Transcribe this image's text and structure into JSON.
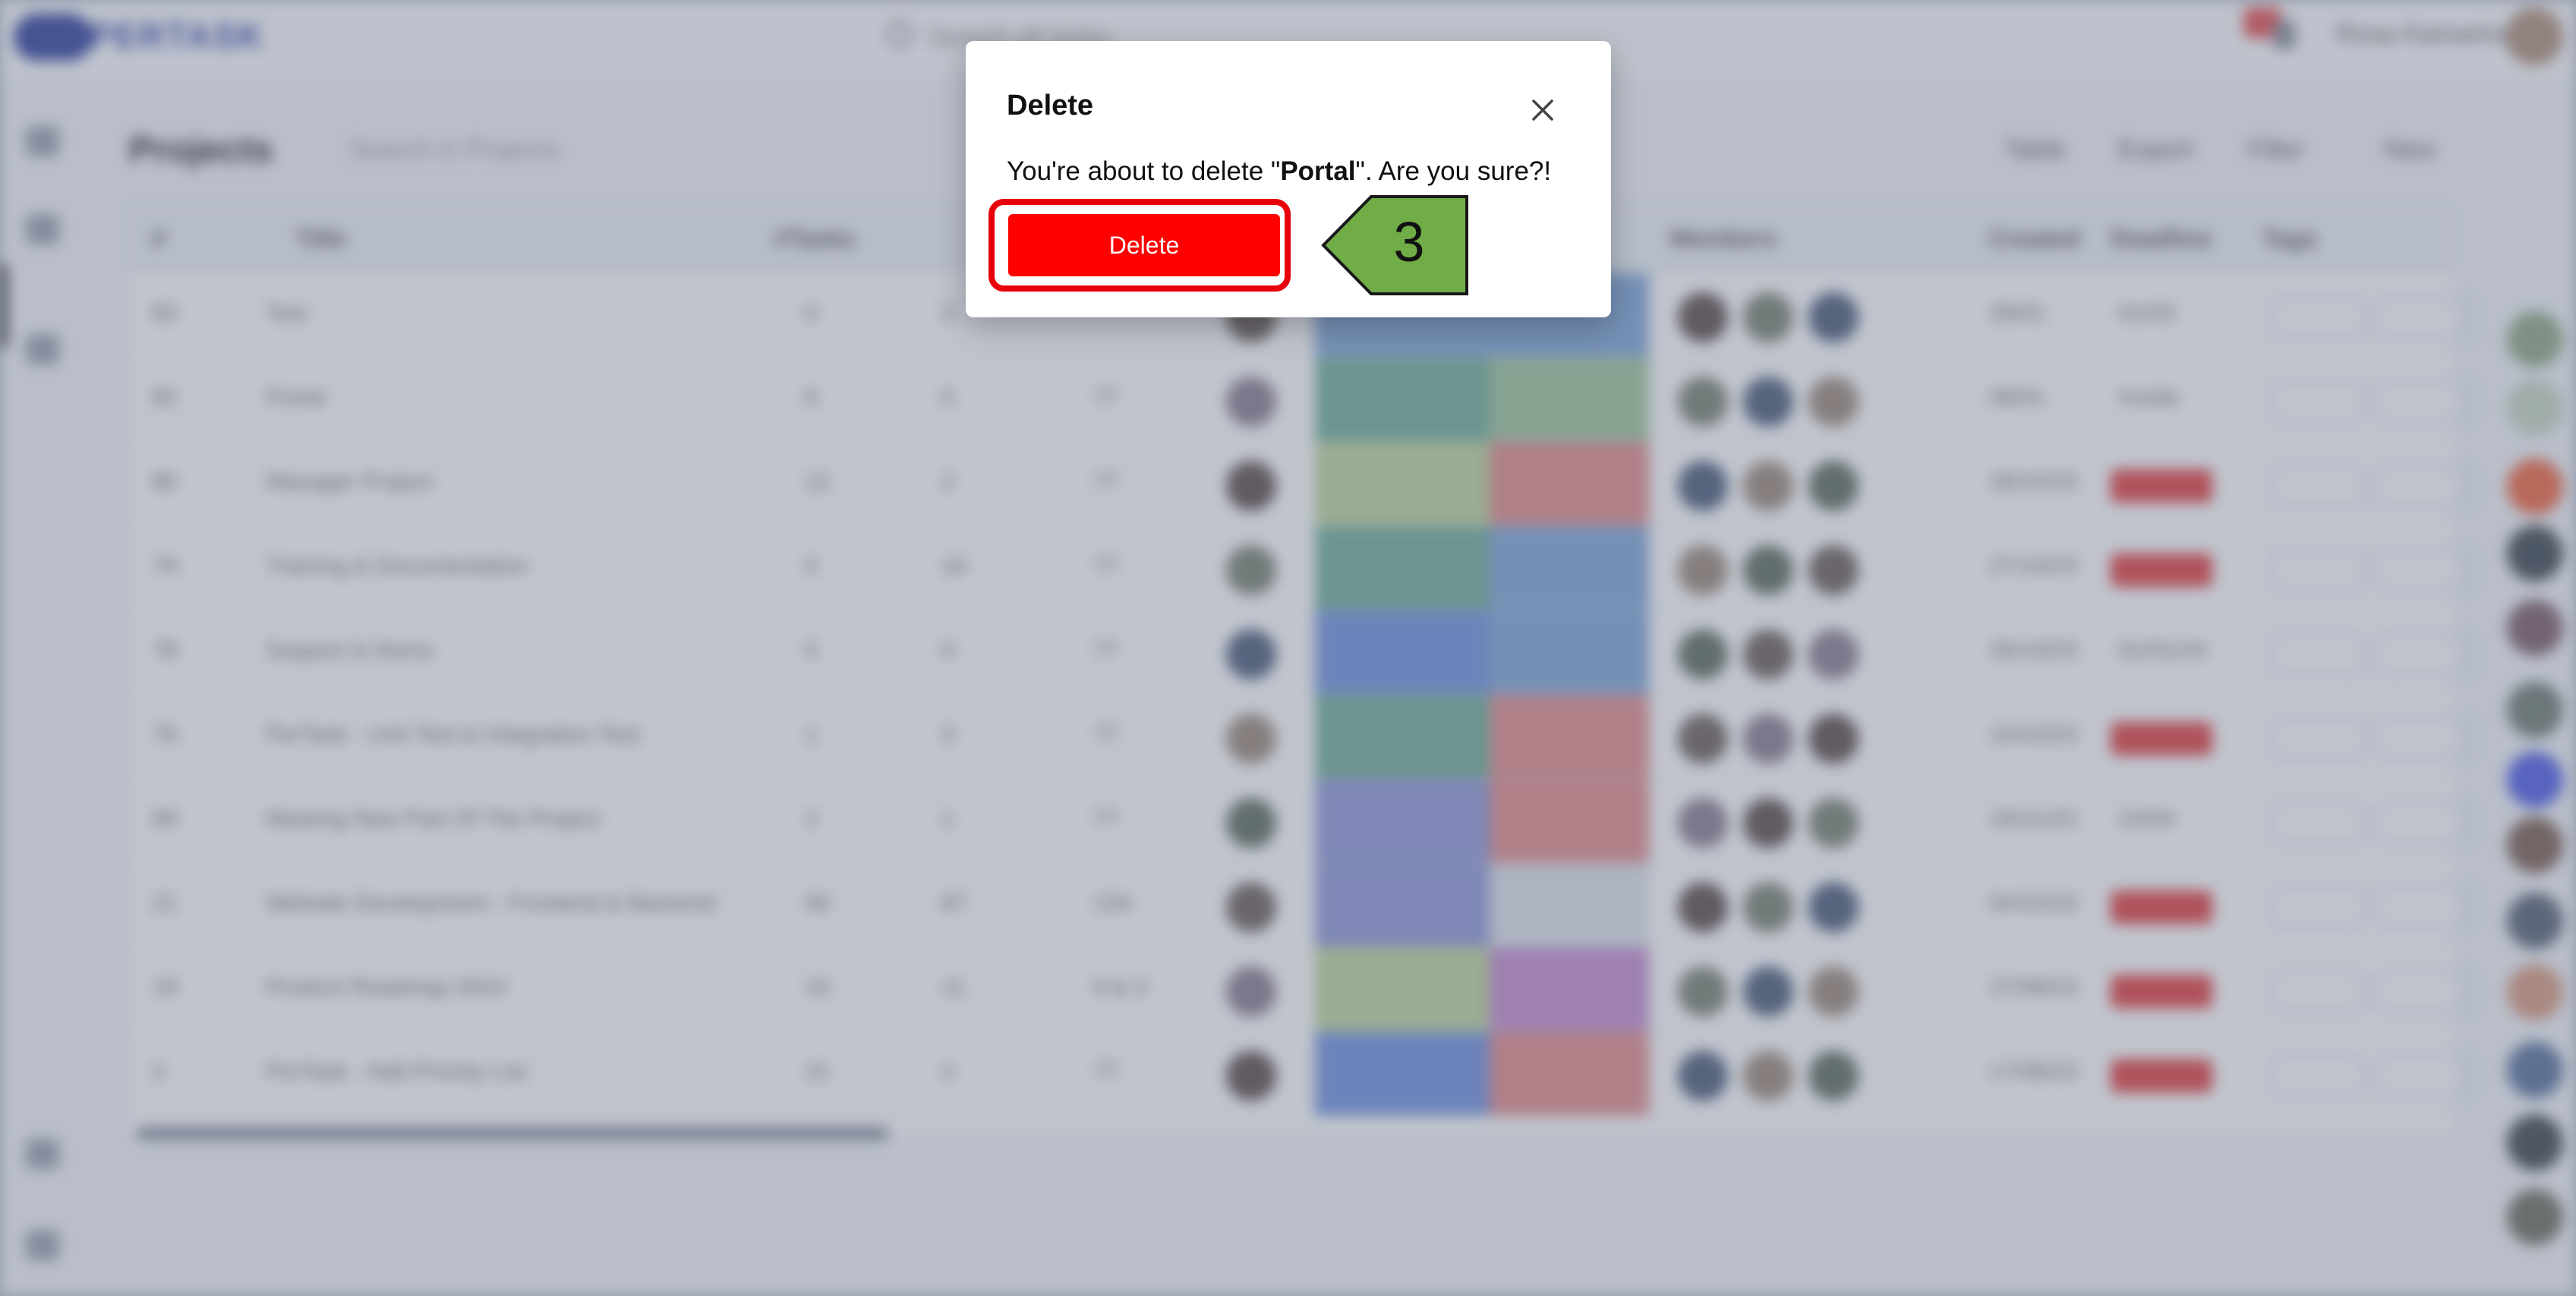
{
  "app": {
    "logo_text": "PERTASK",
    "search_placeholder": "Search all tasks",
    "user_name": "Rosa Kamarina",
    "page_title": "Projects",
    "project_search_placeholder": "Search in Projects",
    "toolbar": [
      "Table",
      "Export",
      "Filter",
      "New"
    ],
    "columns": [
      "#",
      "Title",
      "#Tasks",
      "Members",
      "Created",
      "Deadline",
      "Tags"
    ],
    "rows": [
      {
        "id": "83",
        "title": "Test",
        "tasks": "0",
        "members": "3",
        "col3": "",
        "status_color": "#7fa6d8",
        "priority_color": "#7fa6d8",
        "created": "28/01",
        "deadline": "01/03"
      },
      {
        "id": "82",
        "title": "Portal",
        "tasks": "6",
        "members": "5",
        "col3": "77",
        "status_color": "#6fae98",
        "priority_color": "#9ec79a",
        "created": "08/01",
        "deadline": "Inside"
      },
      {
        "id": "80",
        "title": "Manager Project",
        "tasks": "12",
        "members": "2",
        "col3": "77",
        "status_color": "#bfd79a",
        "priority_color": "#e48a8a",
        "created": "28/10/23",
        "deadline": ""
      },
      {
        "id": "79",
        "title": "Training & Documentation",
        "tasks": "5",
        "members": "16",
        "col3": "77",
        "status_color": "#6fae98",
        "priority_color": "#7fa6d8",
        "created": "27/10/23",
        "deadline": ""
      },
      {
        "id": "78",
        "title": "Support & Demo",
        "tasks": "5",
        "members": "0",
        "col3": "77",
        "status_color": "#6f92e0",
        "priority_color": "#7fa6d8",
        "created": "26/10/23",
        "deadline": "01/01/24"
      },
      {
        "id": "76",
        "title": "PerTask - Unit Test & Integration Test",
        "tasks": "1",
        "members": "3",
        "col3": "77",
        "status_color": "#6fae98",
        "priority_color": "#e48a8a",
        "created": "10/10/23",
        "deadline": ""
      },
      {
        "id": "69",
        "title": "Meeting New Part Of The Project",
        "tasks": "2",
        "members": "1",
        "col3": "77",
        "status_color": "#8f98d8",
        "priority_color": "#e48a8a",
        "created": "18/11/23",
        "deadline": "24/04"
      },
      {
        "id": "21",
        "title": "Website Development - Frontend & Backend",
        "tasks": "56",
        "members": "87",
        "col3": "134",
        "status_color": "#8f98d8",
        "priority_color": "#dfe3e9",
        "created": "04/10/23",
        "deadline": ""
      },
      {
        "id": "19",
        "title": "Product Roadmap 2024",
        "tasks": "10",
        "members": "11",
        "col3": "9 & 3",
        "status_color": "#bfd79a",
        "priority_color": "#c58bd0",
        "created": "27/08/23",
        "deadline": ""
      },
      {
        "id": "3",
        "title": "PerTask - Add Priority List",
        "tasks": "21",
        "members": "2",
        "col3": "77",
        "status_color": "#6f92e0",
        "priority_color": "#e48a8a",
        "created": "17/08/23",
        "deadline": ""
      }
    ]
  },
  "modal": {
    "title": "Delete",
    "message_prefix": "You're about to delete \"",
    "item_name": "Portal",
    "message_suffix": "\". Are you sure?!",
    "delete_label": "Delete",
    "close_icon": "close-icon"
  },
  "annotation": {
    "step_number": "3",
    "highlight_color": "#e8000b",
    "arrow_color": "#70ad47"
  }
}
